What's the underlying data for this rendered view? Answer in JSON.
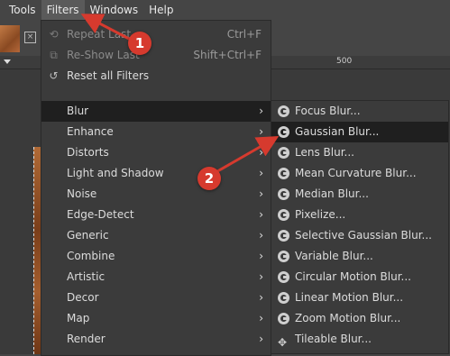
{
  "menubar": {
    "items": [
      "Tools",
      "Filters",
      "Windows",
      "Help"
    ],
    "active_index": 1
  },
  "ruler": {
    "label": "500"
  },
  "filters_menu": {
    "items": [
      {
        "label": "Repeat Last",
        "shortcut": "Ctrl+F",
        "disabled": true,
        "icon": "repeat-icon"
      },
      {
        "label": "Re-Show Last",
        "shortcut": "Shift+Ctrl+F",
        "disabled": true,
        "icon": "reshow-icon"
      },
      {
        "label": "Reset all Filters",
        "shortcut": "",
        "disabled": false,
        "icon": "reset-icon"
      },
      {
        "label": "Blur",
        "submenu": true
      },
      {
        "label": "Enhance",
        "submenu": true
      },
      {
        "label": "Distorts",
        "submenu": true
      },
      {
        "label": "Light and Shadow",
        "submenu": true
      },
      {
        "label": "Noise",
        "submenu": true
      },
      {
        "label": "Edge-Detect",
        "submenu": true
      },
      {
        "label": "Generic",
        "submenu": true
      },
      {
        "label": "Combine",
        "submenu": true
      },
      {
        "label": "Artistic",
        "submenu": true
      },
      {
        "label": "Decor",
        "submenu": true
      },
      {
        "label": "Map",
        "submenu": true
      },
      {
        "label": "Render",
        "submenu": true
      }
    ],
    "highlighted": "Blur"
  },
  "blur_submenu": {
    "items": [
      "Focus Blur...",
      "Gaussian Blur...",
      "Lens Blur...",
      "Mean Curvature Blur...",
      "Median Blur...",
      "Pixelize...",
      "Selective Gaussian Blur...",
      "Variable Blur...",
      "Circular Motion Blur...",
      "Linear Motion Blur...",
      "Zoom Motion Blur...",
      "Tileable Blur..."
    ],
    "highlighted": "Gaussian Blur..."
  },
  "annotations": {
    "step1": "1",
    "step2": "2",
    "color": "#d63a2e"
  },
  "colors": {
    "menu_bg": "#3b3b3b",
    "highlight_bg": "#1f1f1f",
    "app_bg": "#454545"
  }
}
